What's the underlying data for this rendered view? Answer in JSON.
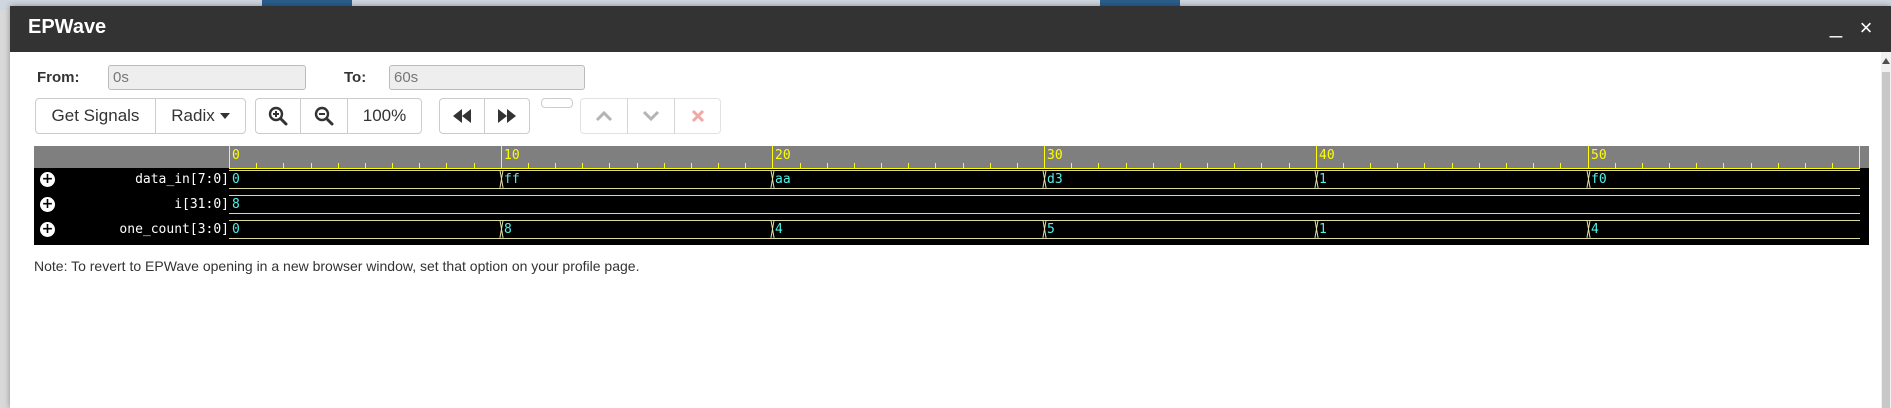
{
  "window": {
    "title": "EPWave",
    "minimize_label": "_",
    "close_label": "×"
  },
  "range": {
    "from_label": "From:",
    "from_value": "0s",
    "to_label": "To:",
    "to_value": "60s"
  },
  "toolbar": {
    "get_signals_label": "Get Signals",
    "radix_label": "Radix",
    "zoom_level": "100%"
  },
  "icons": {
    "zoom_in": "zoom-in-icon",
    "zoom_out": "zoom-out-icon",
    "rewind": "fast-backward-icon",
    "forward": "fast-forward-icon",
    "move_up": "chevron-up-icon",
    "move_down": "chevron-down-icon",
    "remove": "close-x-icon",
    "expand": "plus-circle-icon"
  },
  "ruler": {
    "labels": [
      "0",
      "10",
      "20",
      "30",
      "40",
      "50"
    ]
  },
  "signals": [
    {
      "name": "data_in[7:0]",
      "values": [
        "0",
        "ff",
        "aa",
        "d3",
        "1",
        "f0"
      ]
    },
    {
      "name": "i[31:0]",
      "values": [
        "8"
      ]
    },
    {
      "name": "one_count[3:0]",
      "values": [
        "0",
        "8",
        "4",
        "5",
        "1",
        "4"
      ]
    }
  ],
  "note": "Note: To revert to EPWave opening in a new browser window, set that option on your profile page.",
  "colors": {
    "titlebar": "#333333",
    "ruler": "#7f7f7f",
    "ruler_text": "#ffff00",
    "wave_bg": "#000000",
    "wave_value": "#4ff0e6",
    "remove_icon": "#e8605a"
  }
}
